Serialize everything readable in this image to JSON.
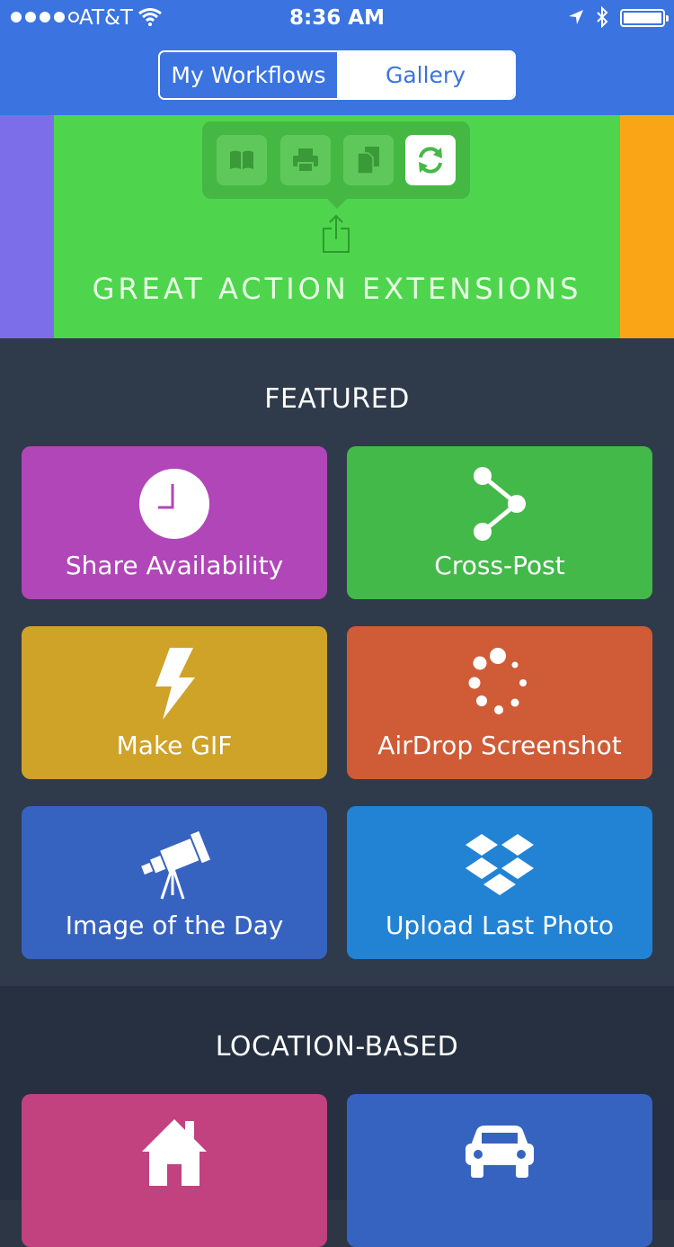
{
  "status_bar": {
    "carrier": "AT&T",
    "time": "8:36 AM"
  },
  "nav": {
    "segments": [
      "My Workflows",
      "Gallery"
    ],
    "selected": "Gallery"
  },
  "hero": {
    "title": "GREAT ACTION EXTENSIONS",
    "extension_icons": [
      "book-icon",
      "printer-icon",
      "documents-icon",
      "sync-icon"
    ],
    "colors": {
      "main": "#4fd54d",
      "left_peek": "#7b6ee8",
      "right_peek": "#f9a516"
    }
  },
  "featured": {
    "title": "FEATURED",
    "tiles": [
      {
        "label": "Share Availability",
        "icon": "clock-icon",
        "color": "#b146b8"
      },
      {
        "label": "Cross-Post",
        "icon": "share-nodes-icon",
        "color": "#43b949"
      },
      {
        "label": "Make GIF",
        "icon": "lightning-icon",
        "color": "#cfa228"
      },
      {
        "label": "AirDrop Screenshot",
        "icon": "airdrop-icon",
        "color": "#cf5c37"
      },
      {
        "label": "Image of the Day",
        "icon": "telescope-icon",
        "color": "#3763c0"
      },
      {
        "label": "Upload Last Photo",
        "icon": "dropbox-icon",
        "color": "#2283d4"
      }
    ]
  },
  "location_based": {
    "title": "LOCATION-BASED",
    "tiles": [
      {
        "label": "",
        "icon": "home-icon",
        "color": "#c1427e"
      },
      {
        "label": "",
        "icon": "car-icon",
        "color": "#3763c0"
      }
    ]
  },
  "colors": {
    "nav_blue": "#3b74e0",
    "featured_bg": "#2f3a4b",
    "location_bg": "#263041"
  }
}
